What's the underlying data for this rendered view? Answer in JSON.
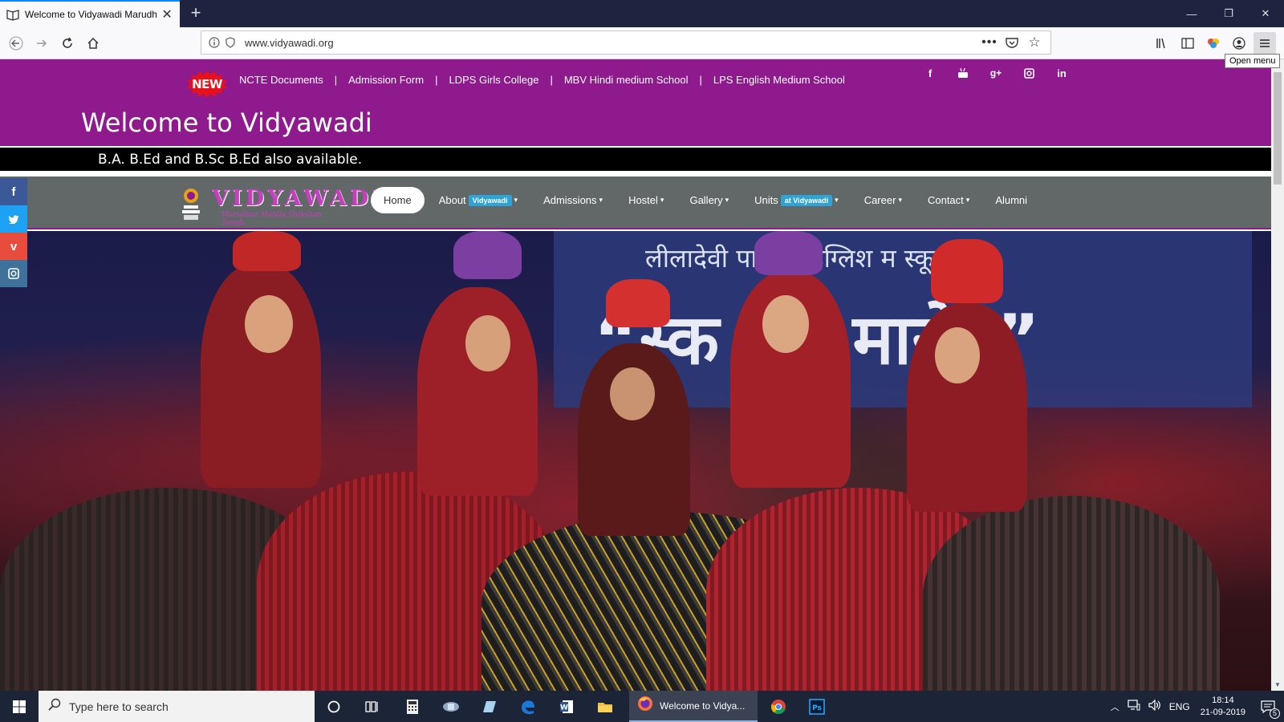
{
  "browser": {
    "tab_title": "Welcome to Vidyawadi Marudh",
    "url": "www.vidyawadi.org",
    "tooltip": "Open menu"
  },
  "top_bar": {
    "new_badge": "NEW",
    "links": [
      "NCTE Documents",
      "Admission Form",
      "LDPS Girls College",
      "MBV Hindi medium School",
      "LPS English Medium School"
    ],
    "social": [
      "f",
      "yt",
      "g+",
      "ig",
      "in"
    ]
  },
  "welcome": "Welcome to Vidyawadi",
  "ticker": "B.A. B.Ed and B.Sc B.Ed also available.",
  "logo": {
    "title": "VIDYAWADI",
    "subtitle": "Marudhar Mahila Shikshan Sangh"
  },
  "nav": {
    "home": "Home",
    "about": "About",
    "about_badge": "Vidyawadi",
    "admissions": "Admissions",
    "hostel": "Hostel",
    "gallery": "Gallery",
    "units": "Units",
    "units_badge": "at Vidyawadi",
    "career": "Career",
    "contact": "Contact",
    "alumni": "Alumni"
  },
  "hero": {
    "banner_line": "लीलादेवी पा     चेती इंग्लिश     म स्कूल",
    "banner_big": "“स्क    तरा    मारोह”"
  },
  "side_social": {
    "colors": [
      "#3b5998",
      "#1da1f2",
      "#e74c3c",
      "#3f729b"
    ]
  },
  "taskbar": {
    "search_placeholder": "Type here to search",
    "active_window": "Welcome to Vidya...",
    "lang": "ENG",
    "time": "18:14",
    "date": "21-09-2019",
    "notifications": "5"
  },
  "colors": {
    "brand_purple": "#8e1a8e",
    "nav_gray": "#616867",
    "badge_blue": "#2ea3d8"
  }
}
